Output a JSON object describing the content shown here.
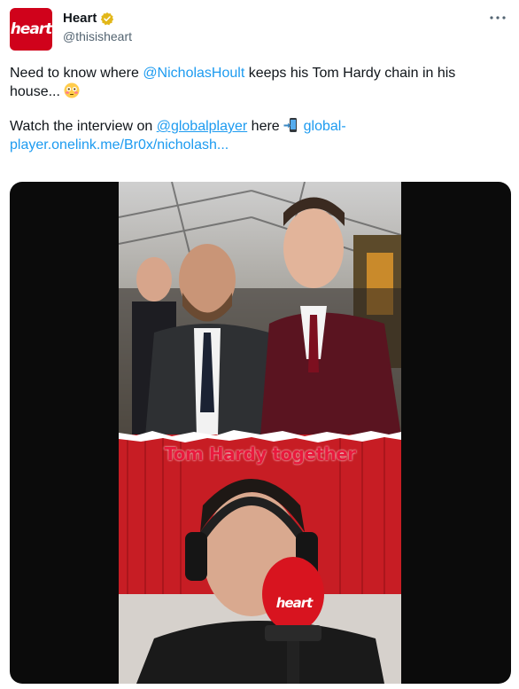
{
  "account": {
    "avatar_text": "heart",
    "display_name": "Heart",
    "handle": "@thisisheart",
    "verified_icon": "gold-verified-badge-icon",
    "more_icon": "more-options-icon",
    "brand_color": "#d0021b"
  },
  "tweet": {
    "line1_prefix": "Need to know where ",
    "line1_mention": "@NicholasHoult",
    "line1_suffix": " keeps his Tom Hardy chain in his house... ",
    "line1_emoji": "flushed-face-emoji",
    "line2_prefix": "Watch the interview on ",
    "line2_mention": "@globalplayer",
    "line2_mid": " here ",
    "line2_emoji": "mobile-phone-arrow-emoji",
    "line2_link": "global-player.onelink.me/Br0x/nicholash..."
  },
  "media": {
    "caption": "Tom Hardy together",
    "mic_logo_text": "heart"
  },
  "colors": {
    "link": "#1d9bf0",
    "caption": "#e8193c",
    "text": "#0f1419",
    "secondary": "#536471"
  }
}
